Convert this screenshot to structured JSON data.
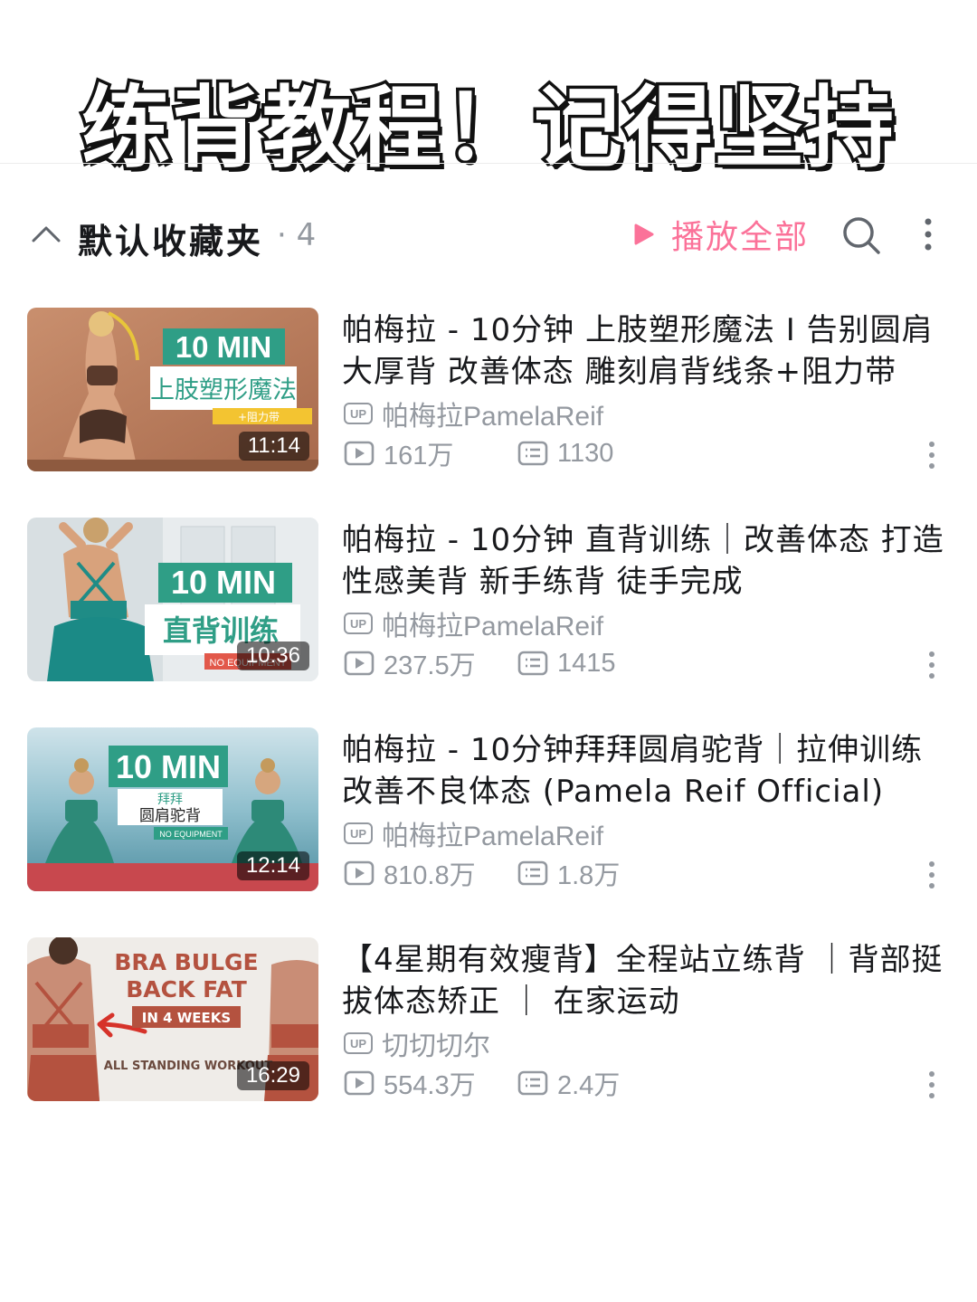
{
  "banner": {
    "title": "练背教程！记得坚持"
  },
  "folder": {
    "name": "默认收藏夹",
    "count": "· 4",
    "play_all_label": "播放全部"
  },
  "videos": [
    {
      "title": "帕梅拉 - 10分钟 上肢塑形魔法 I 告别圆肩大厚背 改善体态 雕刻肩背线条+阻力带",
      "uploader": "帕梅拉PamelaReif",
      "plays": "161万",
      "danmaku": "1130",
      "duration": "11:14",
      "thumb_text": {
        "line1": "10 MIN",
        "line2": "上肢塑形魔法",
        "tag": "+阻力带"
      }
    },
    {
      "title": "帕梅拉 - 10分钟 直背训练｜改善体态 打造性感美背 新手练背 徒手完成",
      "uploader": "帕梅拉PamelaReif",
      "plays": "237.5万",
      "danmaku": "1415",
      "duration": "10:36",
      "thumb_text": {
        "line1": "10 MIN",
        "line2": "直背训练",
        "tag": "NO EQUIPMENT"
      }
    },
    {
      "title": "帕梅拉 - 10分钟拜拜圆肩驼背｜拉伸训练 改善不良体态 (Pamela Reif Official)",
      "uploader": "帕梅拉PamelaReif",
      "plays": "810.8万",
      "danmaku": "1.8万",
      "duration": "12:14",
      "thumb_text": {
        "line1": "10 MIN",
        "line2": "拜拜",
        "line3": "圆肩驼背",
        "tag": "NO EQUIPMENT"
      }
    },
    {
      "title": "【4星期有效瘦背】全程站立练背 ｜背部挺拔体态矫正 ｜ 在家运动",
      "uploader": "切切切尔",
      "plays": "554.3万",
      "danmaku": "2.4万",
      "duration": "16:29",
      "thumb_text": {
        "line1": "BRA BULGE",
        "line2": "BACK FAT",
        "line3": "IN 4 WEEKS",
        "tag": "ALL STANDING WORKOUT"
      }
    }
  ],
  "icons": {
    "collapse": "chevron-up-icon",
    "play_all": "play-triangle-icon",
    "search": "search-icon",
    "more": "more-vertical-icon",
    "play_count": "play-count-icon",
    "danmaku": "danmaku-icon",
    "uploader": "up-badge-icon"
  },
  "colors": {
    "accent": "#fb7299",
    "muted": "#9499a0",
    "text": "#18191c",
    "thumb_green": "#2f9e86"
  }
}
